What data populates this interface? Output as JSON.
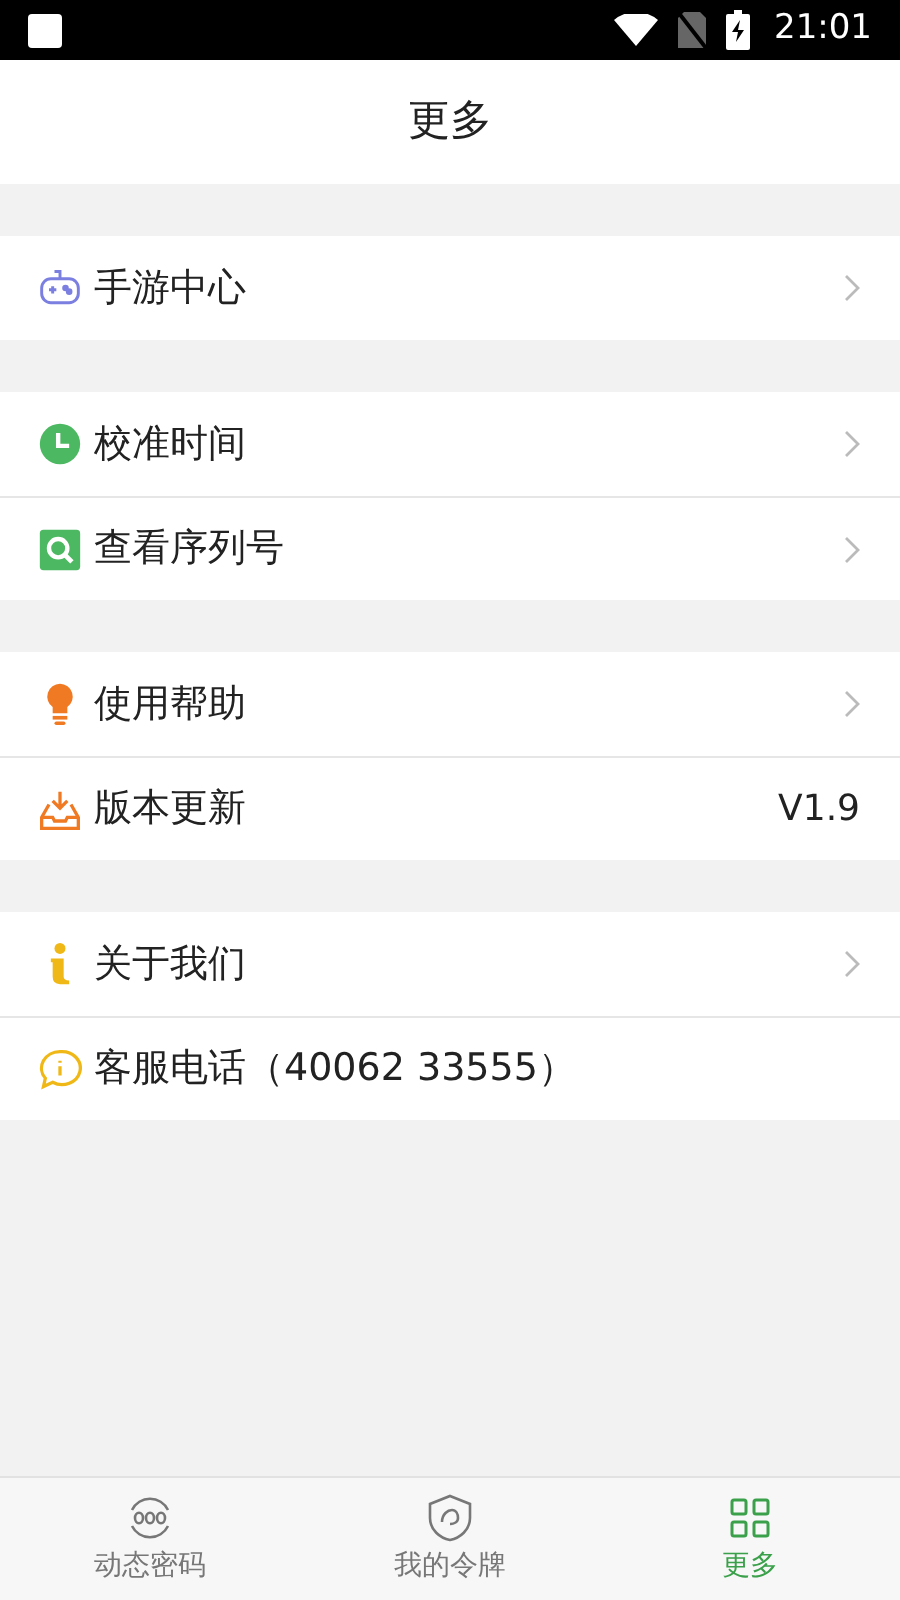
{
  "status_bar": {
    "time": "21:01"
  },
  "header": {
    "title": "更多"
  },
  "groups": [
    {
      "items": [
        {
          "label": "手游中心",
          "chevron": true
        }
      ]
    },
    {
      "items": [
        {
          "label": "校准时间",
          "chevron": true
        },
        {
          "label": "查看序列号",
          "chevron": true
        }
      ]
    },
    {
      "items": [
        {
          "label": "使用帮助",
          "chevron": true
        },
        {
          "label": "版本更新",
          "chevron": false,
          "value": "V1.9"
        }
      ]
    },
    {
      "items": [
        {
          "label": "关于我们",
          "chevron": true
        },
        {
          "label": "客服电话（40062 33555）",
          "chevron": false
        }
      ]
    }
  ],
  "tab_bar": [
    {
      "label": "动态密码",
      "selected": false
    },
    {
      "label": "我的令牌",
      "selected": false
    },
    {
      "label": "更多",
      "selected": true
    }
  ]
}
